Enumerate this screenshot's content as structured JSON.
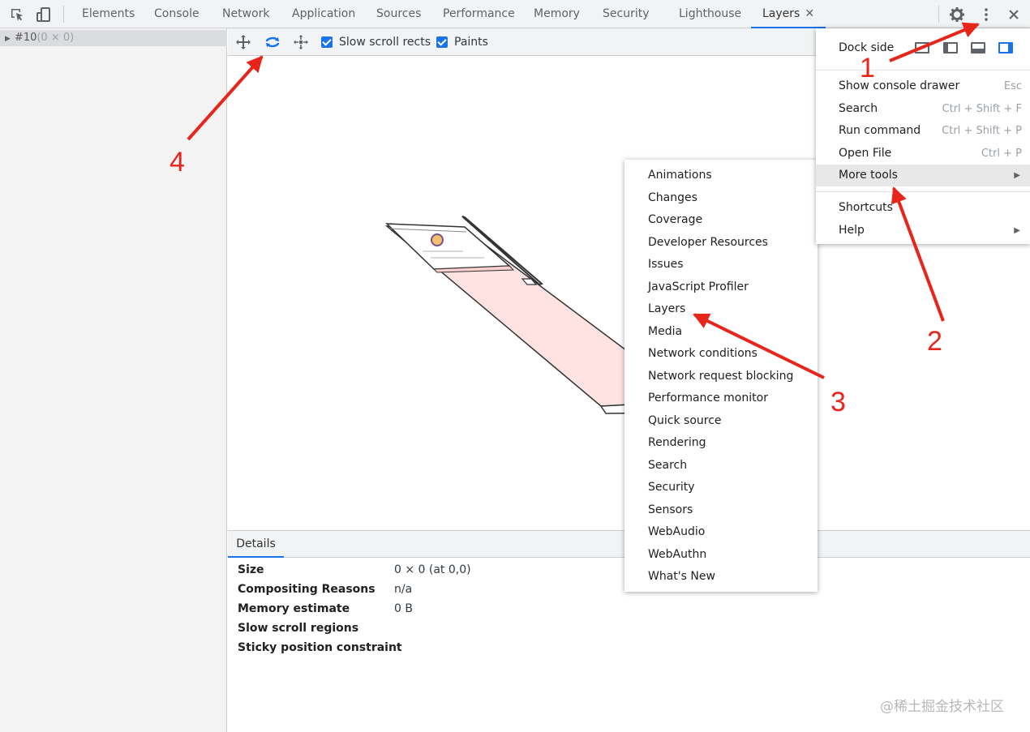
{
  "tabs": [
    "Elements",
    "Console",
    "Network",
    "Application",
    "Sources",
    "Performance",
    "Memory",
    "Security",
    "Lighthouse",
    "Layers"
  ],
  "tab_close": "✕",
  "layer_tree": {
    "label": "#10",
    "size": "(0 × 0)"
  },
  "toolbar": {
    "slow_scroll_rects": "Slow scroll rects",
    "paints": "Paints"
  },
  "details": {
    "tab": "Details",
    "rows": [
      {
        "key": "Size",
        "value": "0 × 0 (at 0,0)"
      },
      {
        "key": "Compositing Reasons",
        "value": "n/a"
      },
      {
        "key": "Memory estimate",
        "value": "0 B"
      },
      {
        "key": "Slow scroll regions",
        "value": ""
      },
      {
        "key": "Sticky position constraint",
        "value": ""
      }
    ]
  },
  "main_menu": {
    "dock_side": "Dock side",
    "items": [
      {
        "label": "Show console drawer",
        "shortcut": "Esc"
      },
      {
        "label": "Search",
        "shortcut": "Ctrl + Shift + F"
      },
      {
        "label": "Run command",
        "shortcut": "Ctrl + Shift + P"
      },
      {
        "label": "Open File",
        "shortcut": "Ctrl + P"
      },
      {
        "label": "More tools",
        "shortcut": ""
      }
    ],
    "items2": [
      {
        "label": "Shortcuts"
      },
      {
        "label": "Help"
      }
    ]
  },
  "more_tools": [
    "Animations",
    "Changes",
    "Coverage",
    "Developer Resources",
    "Issues",
    "JavaScript Profiler",
    "Layers",
    "Media",
    "Network conditions",
    "Network request blocking",
    "Performance monitor",
    "Quick source",
    "Rendering",
    "Search",
    "Security",
    "Sensors",
    "WebAudio",
    "WebAuthn",
    "What's New"
  ],
  "annotations": [
    "1",
    "2",
    "3",
    "4"
  ],
  "watermark": "@稀土掘金技术社区",
  "colors": {
    "accent": "#1a73e8",
    "annotation": "#e8251a",
    "layer_fill": "#ffe3e3"
  }
}
